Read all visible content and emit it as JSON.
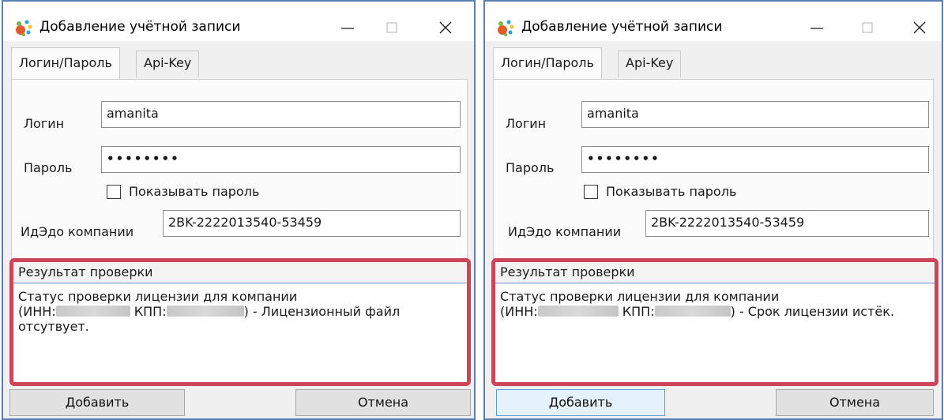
{
  "dialogs": [
    {
      "title": "Добавление учётной записи",
      "tabs": [
        "Логин/Пароль",
        "Api-Key"
      ],
      "login_label": "Логин",
      "login_value": "amanita",
      "password_label": "Пароль",
      "password_value": "••••••••",
      "show_password_label": "Показывать пароль",
      "edo_label": "ИдЭдо компании",
      "edo_value": "2BK-2222013540-53459",
      "result_header": "Результат проверки",
      "result_line1": "Статус проверки лицензии для компании",
      "result_inn": "(ИНН:",
      "result_kpp": "КПП:",
      "result_status": ") - Лицензионный файл",
      "result_line3": "отсутвует.",
      "add_button": "Добавить",
      "cancel_button": "Отмена"
    },
    {
      "title": "Добавление учётной записи",
      "tabs": [
        "Логин/Пароль",
        "Api-Key"
      ],
      "login_label": "Логин",
      "login_value": "amanita",
      "password_label": "Пароль",
      "password_value": "••••••••",
      "show_password_label": "Показывать пароль",
      "edo_label": "ИдЭдо компании",
      "edo_value": "2BK-2222013540-53459",
      "result_header": "Результат проверки",
      "result_line1": "Статус проверки лицензии для компании",
      "result_inn": "(ИНН:",
      "result_kpp": "КПП:",
      "result_status": ") - Срок лицензии истёк.",
      "result_line3": "",
      "add_button": "Добавить",
      "cancel_button": "Отмена"
    }
  ],
  "colors": {
    "window_border": "#5a7fb5",
    "highlight_border": "#cc4559",
    "default_button_border": "#5aa0d8"
  },
  "icons": [
    "app-logo-icon",
    "minimize-icon",
    "maximize-icon",
    "close-icon",
    "checkbox-icon"
  ]
}
